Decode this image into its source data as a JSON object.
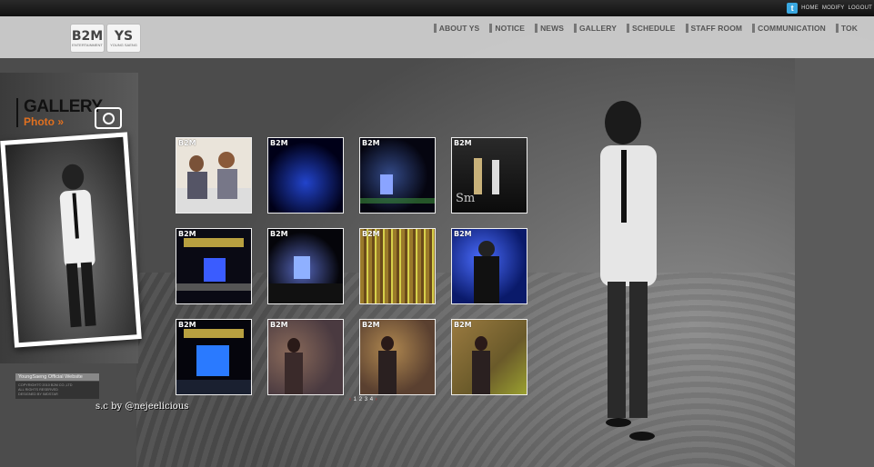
{
  "utility_links": [
    "HOME",
    "MODIFY",
    "LOGOUT"
  ],
  "icons": {
    "twitter": "twitter-icon",
    "camera": "camera-icon"
  },
  "logo": {
    "brand": "B2M",
    "brand_sub": "ENTERTAINMENT",
    "artist": "YS",
    "artist_sub": "YOUNG SAENG"
  },
  "nav": [
    "ABOUT YS",
    "NOTICE",
    "NEWS",
    "GALLERY",
    "SCHEDULE",
    "STAFF ROOM",
    "COMMUNICATION",
    "TOK"
  ],
  "gallery": {
    "title": "GALLERY",
    "subtitle": "Photo »"
  },
  "footer": {
    "site": "YoungSaeng Official Website",
    "copyright": "COPYRIGHT© 2010 B2M CO.,LTD",
    "rights": "ALL RIGHTS RESERVED",
    "designed": "DESIGNED BY IMDSTAR"
  },
  "credit": "s.c by @nejeelicious",
  "thumbnails": [
    {
      "watermark": "B2M",
      "scene": "press"
    },
    {
      "watermark": "B2M",
      "scene": "blue-stage"
    },
    {
      "watermark": "B2M",
      "scene": "dark-stage"
    },
    {
      "watermark": "B2M",
      "scene": "stage-duo"
    },
    {
      "watermark": "B2M",
      "scene": "banner-stage"
    },
    {
      "watermark": "B2M",
      "scene": "wide-stage"
    },
    {
      "watermark": "B2M",
      "scene": "crowd"
    },
    {
      "watermark": "B2M",
      "scene": "singer-blue"
    },
    {
      "watermark": "B2M",
      "scene": "banner-stage2"
    },
    {
      "watermark": "B2M",
      "scene": "warm-1"
    },
    {
      "watermark": "B2M",
      "scene": "warm-2"
    },
    {
      "watermark": "B2M",
      "scene": "warm-3"
    }
  ],
  "pager": {
    "prev": "‹",
    "pages": [
      "1",
      "2",
      "3",
      "4"
    ],
    "current": "1",
    "next": "›"
  },
  "colors": {
    "accent": "#e07020",
    "twitter": "#39a7e0",
    "pager_current": "#dd3333"
  }
}
